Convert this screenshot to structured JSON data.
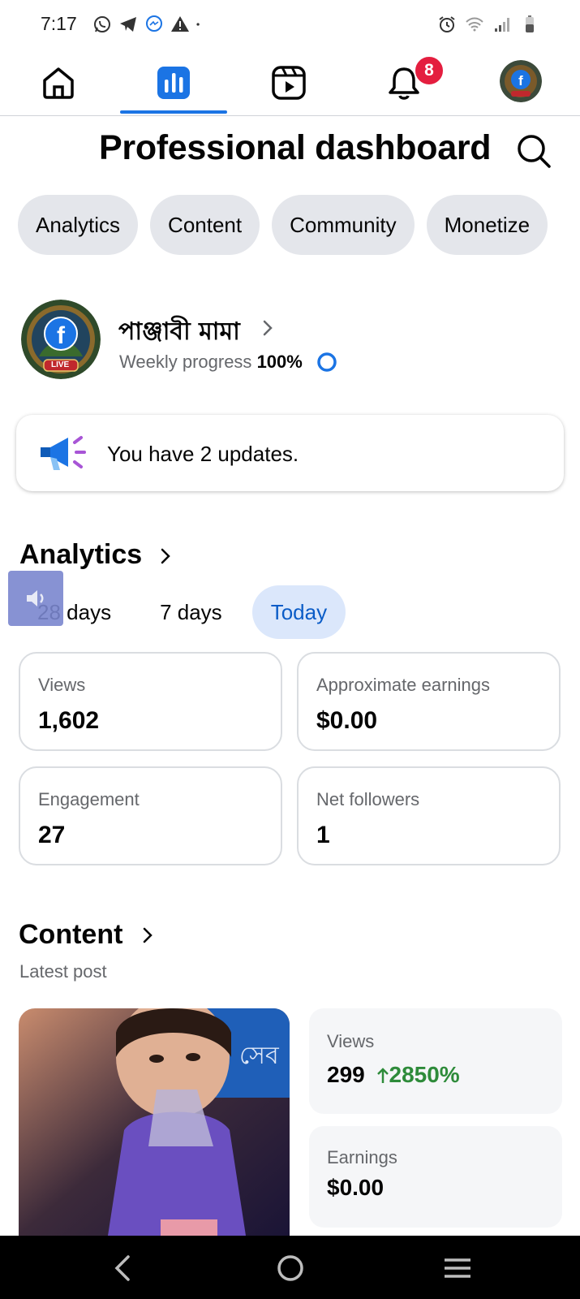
{
  "status_bar": {
    "time": "7:17",
    "left_icons": [
      "whatsapp-icon",
      "telegram-icon",
      "messenger-icon",
      "warning-icon",
      "dot-icon"
    ],
    "right_icons": [
      "alarm-icon",
      "wifi-icon",
      "signal-icon",
      "battery-icon"
    ]
  },
  "top_nav": {
    "items": [
      "home-icon",
      "dashboard-icon",
      "reels-icon",
      "bell-icon",
      "profile-avatar"
    ],
    "active": "dashboard-icon",
    "notifications_count": "8"
  },
  "header": {
    "title": "Professional dashboard"
  },
  "chips": [
    "Analytics",
    "Content",
    "Community",
    "Monetize"
  ],
  "profile": {
    "name": "পাঞ্জাবী মামা",
    "progress_label": "Weekly progress",
    "progress_value": "100%",
    "avatar_badge": "LIVE"
  },
  "updates": {
    "text": "You have 2 updates."
  },
  "analytics": {
    "title": "Analytics",
    "ranges": [
      "28 days",
      "7 days",
      "Today"
    ],
    "active_range": "Today",
    "stats": [
      {
        "label": "Views",
        "value": "1,602"
      },
      {
        "label": "Approximate earnings",
        "value": "$0.00"
      },
      {
        "label": "Engagement",
        "value": "27"
      },
      {
        "label": "Net followers",
        "value": "1"
      }
    ]
  },
  "content": {
    "title": "Content",
    "subtitle": "Latest post",
    "post_stats": {
      "views_label": "Views",
      "views_value": "299",
      "views_growth": "2850%",
      "earnings_label": "Earnings",
      "earnings_value": "$0.00"
    },
    "thumbnail_text": "সেব"
  },
  "colors": {
    "accent": "#1b74e4",
    "badge": "#e41e3f",
    "growth": "#2e8b3a",
    "chip_bg": "#e4e6eb"
  }
}
